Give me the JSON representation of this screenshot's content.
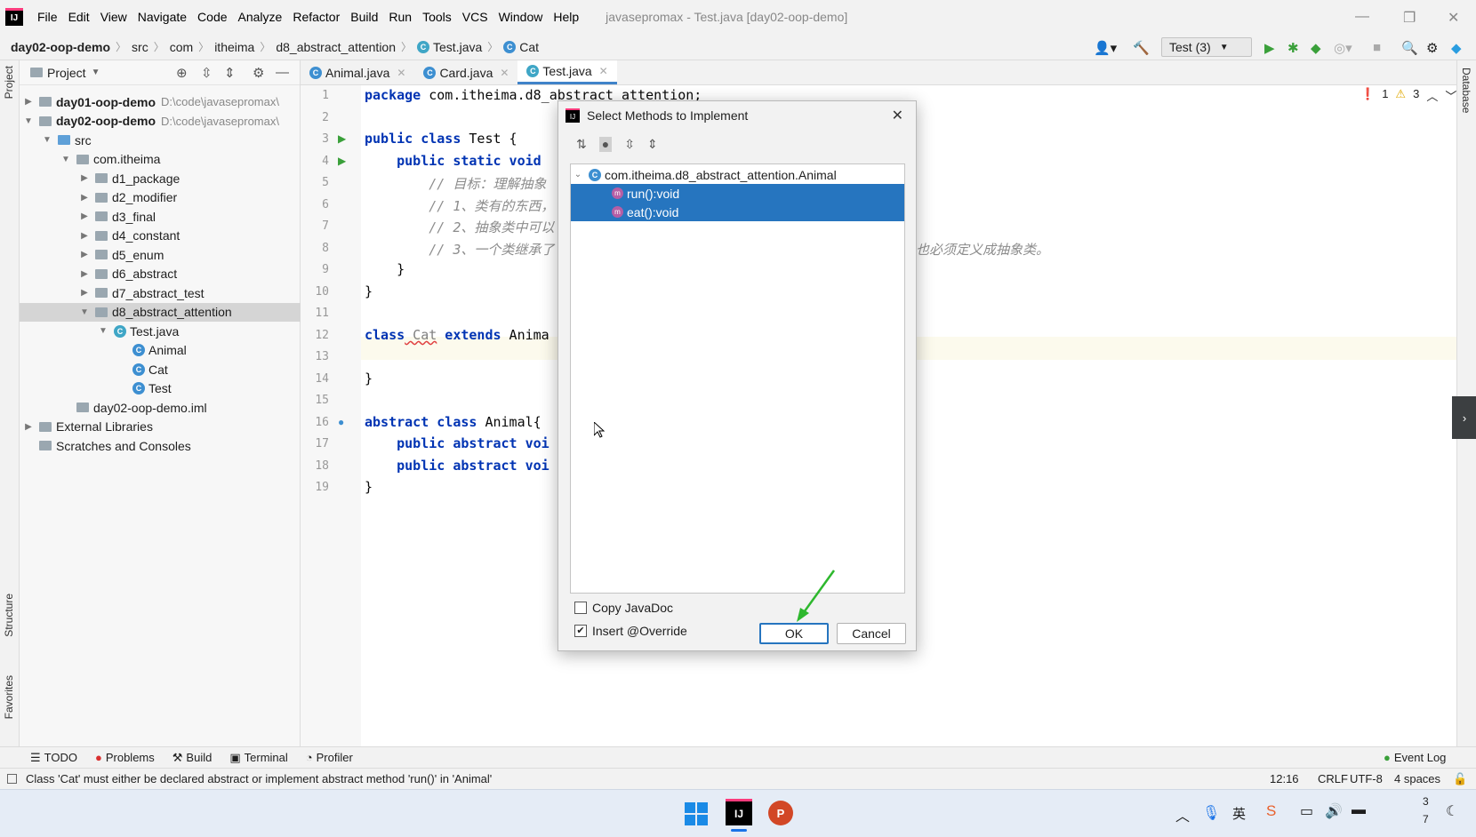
{
  "menu": {
    "items": [
      "File",
      "Edit",
      "View",
      "Navigate",
      "Code",
      "Analyze",
      "Refactor",
      "Build",
      "Run",
      "Tools",
      "VCS",
      "Window",
      "Help"
    ],
    "window_title": "javasepromax - Test.java [day02-oop-demo]"
  },
  "breadcrumbs": [
    "day02-oop-demo",
    "src",
    "com",
    "itheima",
    "d8_abstract_attention",
    "Test.java",
    "Cat"
  ],
  "run_config": "Test (3)",
  "left_strip": {
    "project": "Project",
    "structure": "Structure",
    "favorites": "Favorites"
  },
  "right_strip": {
    "database": "Database"
  },
  "project_panel": {
    "title": "Project",
    "tree": [
      {
        "label": "day01-oop-demo",
        "path": "D:\\code\\javasepromax\\",
        "level": 0,
        "arrow": "right",
        "bold": true
      },
      {
        "label": "day02-oop-demo",
        "path": "D:\\code\\javasepromax\\",
        "level": 0,
        "arrow": "down",
        "bold": true
      },
      {
        "label": "src",
        "path": "",
        "level": 1,
        "arrow": "down"
      },
      {
        "label": "com.itheima",
        "path": "",
        "level": 2,
        "arrow": "down"
      },
      {
        "label": "d1_package",
        "path": "",
        "level": 3,
        "arrow": "right"
      },
      {
        "label": "d2_modifier",
        "path": "",
        "level": 3,
        "arrow": "right"
      },
      {
        "label": "d3_final",
        "path": "",
        "level": 3,
        "arrow": "right"
      },
      {
        "label": "d4_constant",
        "path": "",
        "level": 3,
        "arrow": "right"
      },
      {
        "label": "d5_enum",
        "path": "",
        "level": 3,
        "arrow": "right"
      },
      {
        "label": "d6_abstract",
        "path": "",
        "level": 3,
        "arrow": "right"
      },
      {
        "label": "d7_abstract_test",
        "path": "",
        "level": 3,
        "arrow": "right"
      },
      {
        "label": "d8_abstract_attention",
        "path": "",
        "level": 3,
        "arrow": "down",
        "selected": true
      },
      {
        "label": "Test.java",
        "path": "",
        "level": 4,
        "arrow": "down"
      },
      {
        "label": "Animal",
        "path": "",
        "level": 5,
        "arrow": ""
      },
      {
        "label": "Cat",
        "path": "",
        "level": 5,
        "arrow": ""
      },
      {
        "label": "Test",
        "path": "",
        "level": 5,
        "arrow": ""
      },
      {
        "label": "day02-oop-demo.iml",
        "path": "",
        "level": 2,
        "arrow": ""
      },
      {
        "label": "External Libraries",
        "path": "",
        "level": 0,
        "arrow": "right"
      },
      {
        "label": "Scratches and Consoles",
        "path": "",
        "level": 0,
        "arrow": ""
      }
    ]
  },
  "editor": {
    "tabs": [
      "Animal.java",
      "Card.java",
      "Test.java"
    ],
    "active_tab": 2,
    "line_numbers": [
      "1",
      "2",
      "3",
      "4",
      "5",
      "6",
      "7",
      "8",
      "9",
      "10",
      "11",
      "12",
      "13",
      "14",
      "15",
      "16",
      "17",
      "18",
      "19"
    ],
    "lines": {
      "l1_kw": "package",
      "l1_rest": " com.itheima.d8_abstract_attention;",
      "l3_kw": "public class",
      "l3_rest": " Test {",
      "l4_kw": "    public static void",
      "l5": "        // 目标：理解抽象",
      "l6": "        // 1、类有的东西，",
      "l7": "        // 2、抽象类中可以",
      "l8": "        // 3、一个类继承了",
      "l8_tail": "也必须定义成抽象类。",
      "l9": "    }",
      "l10": "}",
      "l12_kw": "class",
      "l12_cls": " Cat",
      "l12_kw2": " extends",
      "l12_rest": " Anima",
      "l14": "}",
      "l16_kw": "abstract class",
      "l16_rest": " Animal{",
      "l17_kw": "    public abstract",
      "l17_rest": " voi",
      "l18_kw": "    public abstract",
      "l18_rest": " voi",
      "l19": "}"
    },
    "errors": "1",
    "warnings": "3"
  },
  "dialog": {
    "title": "Select Methods to Implement",
    "root": "com.itheima.d8_abstract_attention.Animal",
    "methods": [
      "run():void",
      "eat():void"
    ],
    "copy_javadoc": "Copy JavaDoc",
    "insert_override": "Insert @Override",
    "ok": "OK",
    "cancel": "Cancel"
  },
  "tool_tabs": [
    "TODO",
    "Problems",
    "Build",
    "Terminal",
    "Profiler"
  ],
  "event_log": "Event Log",
  "status": {
    "message": "Class 'Cat' must either be declared abstract or implement abstract method 'run()' in 'Animal'",
    "position": "12:16",
    "line_sep": "CRLF",
    "encoding": "UTF-8",
    "indent": "4 spaces"
  },
  "taskbar": {
    "clock_top": "3",
    "clock_bottom": "7"
  },
  "colors": {
    "accent": "#2675bf",
    "selection": "#2675bf",
    "keyword": "#0033b3",
    "comment": "#8c8c8c"
  }
}
